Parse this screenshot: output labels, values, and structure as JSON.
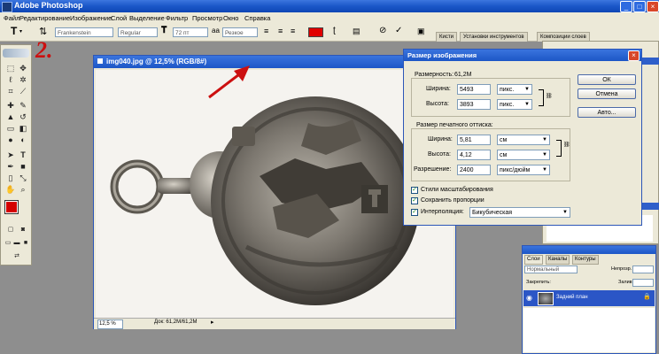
{
  "app": {
    "title": "Adobe Photoshop"
  },
  "menu": [
    "Файл",
    "Редактирование",
    "Изображение",
    "Слой",
    "Выделение",
    "Фильтр",
    "Просмотр",
    "Окно",
    "Справка"
  ],
  "options": {
    "tool_letter": "T",
    "font_family": "Frankenstein",
    "font_style": "Regular",
    "font_size": "72 пт",
    "aa_label": "aa",
    "antialias": "Резкое",
    "text_color": "#e00000",
    "panel_tabs": [
      "Кисти",
      "Установки инструментов",
      "Композиции слоев"
    ]
  },
  "annotation": {
    "number": "2.",
    "arrow_color": "#cc1010"
  },
  "document": {
    "title": "img040.jpg @ 12,5% (RGB/8#)",
    "zoom": "12,5 %",
    "doc_info": "Док: 61,2M/61,2M"
  },
  "dialog": {
    "title": "Размер изображения",
    "pixel_dims_label": "Размерность:",
    "pixel_dims_value": "61,2M",
    "width_label": "Ширина:",
    "width_value": "5493",
    "width_unit": "пикс.",
    "height_label": "Высота:",
    "height_value": "3893",
    "height_unit": "пикс.",
    "print_size_label": "Размер печатного оттиска:",
    "print_width_label": "Ширина:",
    "print_width_value": "5,81",
    "print_width_unit": "см",
    "print_height_label": "Высота:",
    "print_height_value": "4,12",
    "print_height_unit": "см",
    "resolution_label": "Разрешение:",
    "resolution_value": "2400",
    "resolution_unit": "пикс/дюйм",
    "scale_styles_label": "Стили масштабирования",
    "constrain_label": "Сохранить пропорции",
    "interp_label": "Интерполяция:",
    "interp_value": "Бикубическая",
    "ok_label": "ОК",
    "cancel_label": "Отмена",
    "auto_label": "Авто..."
  },
  "layers_panel": {
    "tabs": [
      "Слои",
      "Каналы",
      "Контуры"
    ],
    "blend_mode": "Нормальный",
    "opacity_label": "Непрозр.",
    "lock_label": "Закрепить:",
    "fill_label": "Залив.",
    "layer_name": "Задний план"
  }
}
